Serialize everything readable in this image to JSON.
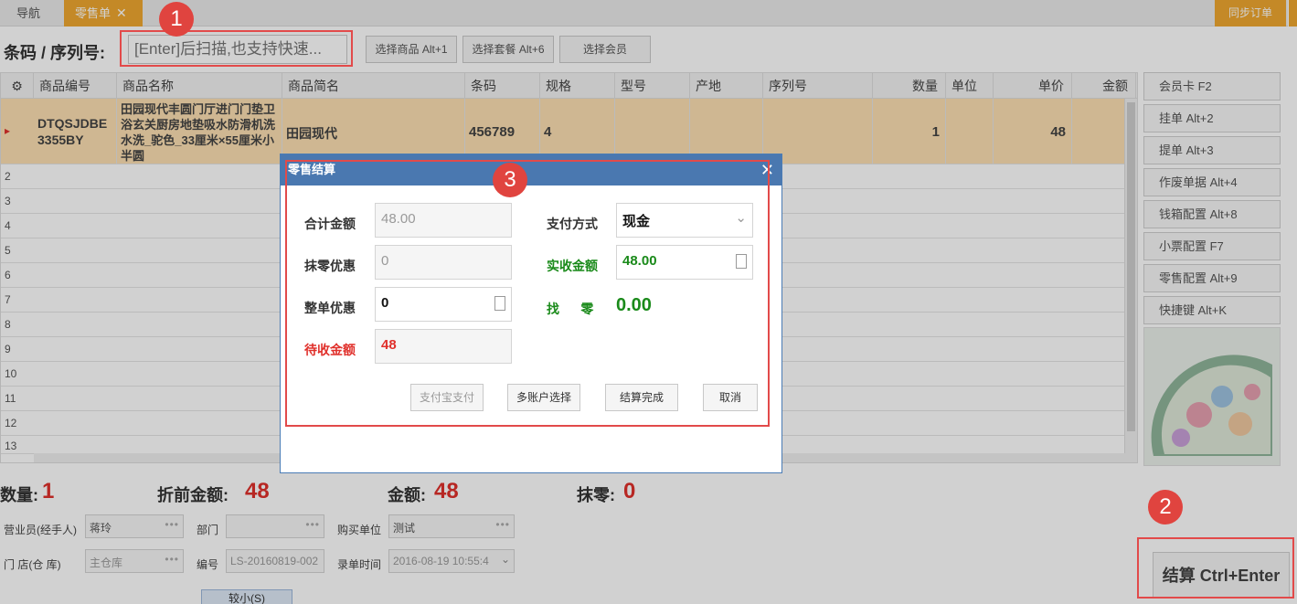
{
  "tabs": {
    "nav": "导航",
    "active": "零售单",
    "close_glyph": "✕"
  },
  "sync_button": "同步订单",
  "barcode": {
    "label": "条码 / 序列号:",
    "placeholder": "[Enter]后扫描,也支持快速..."
  },
  "top_buttons": {
    "select_product": "选择商品 Alt+1",
    "select_package": "选择套餐 Alt+6",
    "select_member": "选择会员"
  },
  "table": {
    "headers": [
      "商品编号",
      "商品名称",
      "商品简名",
      "条码",
      "规格",
      "型号",
      "产地",
      "序列号",
      "数量",
      "单位",
      "单价",
      "金额"
    ],
    "row1": {
      "code": "DTQSJDBE3355BY",
      "name": "田园现代丰圆门厅进门门垫卫浴玄关厨房地垫吸水防滑机洗水洗_驼色_33厘米×55厘米小半圆",
      "short_name": "田园现代",
      "barcode": "456789",
      "spec": "4",
      "qty": "1",
      "price": "48"
    },
    "row_numbers": [
      "2",
      "3",
      "4",
      "5",
      "6",
      "7",
      "8",
      "9",
      "10",
      "11",
      "12",
      "13"
    ]
  },
  "side_buttons": [
    "会员卡 F2",
    "挂单 Alt+2",
    "提单 Alt+3",
    "作废单据 Alt+4",
    "钱箱配置 Alt+8",
    "小票配置 F7",
    "零售配置 Alt+9",
    "快捷键 Alt+K"
  ],
  "summary": {
    "qty_label": "数量:",
    "qty": "1",
    "pre_label": "折前金额:",
    "pre": "48",
    "amount_label": "金额:",
    "amount": "48",
    "round_label": "抹零:",
    "round": "0"
  },
  "form": {
    "salesperson_label": "营业员(经手人)",
    "salesperson": "蒋玲",
    "dept_label": "部门",
    "dept": "",
    "buyer_label": "购买单位",
    "buyer": "测试",
    "store_label": "门  店(仓  库)",
    "store": "主仓库",
    "number_label": "编号",
    "number": "LS-20160819-002",
    "time_label": "录单时间",
    "time": "2016-08-19 10:55:4"
  },
  "small_button": "较小(S)",
  "settle_button": "结算 Ctrl+Enter",
  "dialog": {
    "title": "零售结算",
    "total_label": "合计金额",
    "total": "48.00",
    "odd_label": "抹零优惠",
    "odd": "0",
    "discount_label": "整单优惠",
    "discount": "0",
    "due_label": "待收金额",
    "due": "48",
    "pay_label": "支付方式",
    "pay": "现金",
    "received_label": "实收金额",
    "received": "48.00",
    "change_label": "找      零",
    "change": "0.00",
    "buttons": {
      "alipay": "支付宝支付",
      "multi": "多账户选择",
      "done": "结算完成",
      "cancel": "取消"
    }
  },
  "badges": [
    "1",
    "2",
    "3"
  ],
  "colors": {
    "accent_orange": "#f0a830",
    "dialog_blue": "#4a78b0",
    "red": "#e0302b",
    "green": "#1a8a1a",
    "annotation_red": "#e24a4a"
  }
}
